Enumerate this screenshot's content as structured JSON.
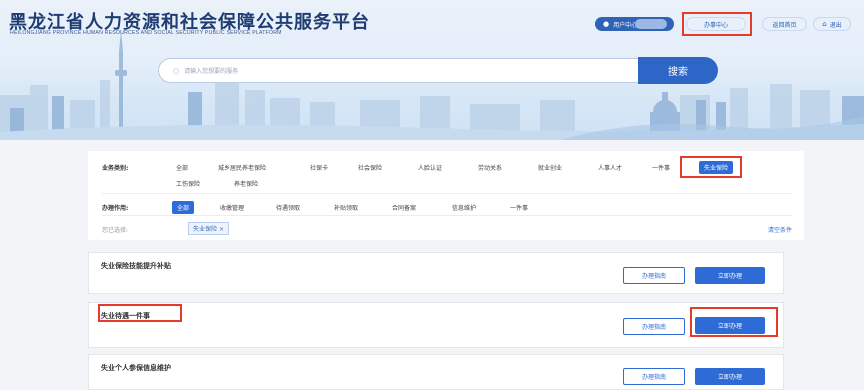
{
  "header": {
    "title": "黑龙江省人力资源和社会保障公共服务平台",
    "subtitle": "HEILONGJIANG PROVINCE HUMAN RESOURCES AND SOCIAL SECURITY PUBLIC SERVICE PLATFORM",
    "user_label": "用户中心:",
    "office_center": "办事中心",
    "back_home": "返回首页",
    "logout": "退出"
  },
  "search": {
    "placeholder": "请输入您想要的服务",
    "button": "搜索"
  },
  "filters": {
    "category_label": "业务类别:",
    "categories": [
      "全部",
      "城乡居民养老保险",
      "社保卡",
      "社会保险",
      "人脸认证",
      "劳动关系",
      "就业创业",
      "人事人才",
      "一件事",
      "失业保险",
      "工伤保险",
      "养老保险"
    ],
    "action_label": "办理作用:",
    "actions": [
      "全部",
      "收缴管理",
      "待遇领取",
      "补贴领取",
      "合同备案",
      "信息维护",
      "一件事"
    ],
    "selected_label": "您已选择:",
    "selected_tag": "失业保险",
    "clear": "清空条件"
  },
  "services": [
    {
      "title": "失业保险技能提升补贴",
      "guide": "办理指南",
      "apply": "立即办理"
    },
    {
      "title": "失业待遇一件事",
      "guide": "办理指南",
      "apply": "立即办理"
    },
    {
      "title": "失业个人参保信息维护",
      "guide": "办理指南",
      "apply": "立即办理"
    }
  ],
  "colors": {
    "accent": "#2e6bd6",
    "highlight": "#e53b2c",
    "title": "#1f3c73"
  }
}
